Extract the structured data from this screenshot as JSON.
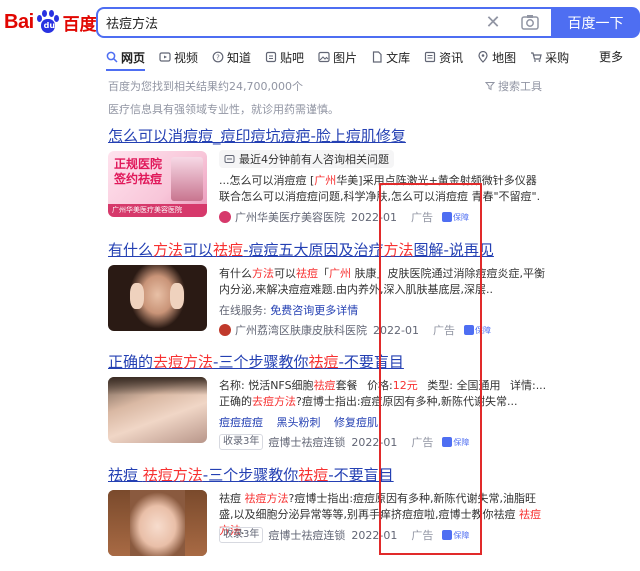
{
  "logo": {
    "bai": "Bai",
    "du": "百度"
  },
  "search": {
    "query": "祛痘方法",
    "button": "百度一下"
  },
  "tabs": [
    {
      "label": "网页",
      "icon": "search-icon"
    },
    {
      "label": "视频",
      "icon": "video-icon"
    },
    {
      "label": "知道",
      "icon": "question-icon"
    },
    {
      "label": "贴吧",
      "icon": "forum-icon"
    },
    {
      "label": "图片",
      "icon": "image-icon"
    },
    {
      "label": "文库",
      "icon": "document-icon"
    },
    {
      "label": "资讯",
      "icon": "news-icon"
    },
    {
      "label": "地图",
      "icon": "map-icon"
    },
    {
      "label": "采购",
      "icon": "cart-icon"
    }
  ],
  "more": "更多",
  "stats": "百度为您找到相关结果约24,700,000个",
  "tools": "搜索工具",
  "notice": "医疗信息具有强领域专业性，就诊用药需谨慎。",
  "results": [
    {
      "title": "怎么可以消痘痘_痘印痘坑痘疤-脸上痘肌修复",
      "sub": "最近4分钟前有人咨询相关问题",
      "thumb_text": "正规医院 签约祛痘",
      "thumb_caption": "广州华美医疗美容医院",
      "desc_a": "...怎么可以消痘痘 [",
      "desc_hl": "广州",
      "desc_b": "华美]采用点阵激光+黄金射频微针多仪器联合怎么可以消痘痘问题,科学净肤,怎么可以消痘痘 青春\"不留痘\".",
      "source": "广州华美医疗美容医院",
      "date": "2022-01",
      "ad": "广告",
      "guarantee": "保障"
    },
    {
      "title_a": "有什么",
      "title_hl1": "方法",
      "title_b": "可以",
      "title_hl2": "祛痘",
      "title_c": "-痘痘五大原因及治疗",
      "title_hl3": "方法",
      "title_d": "图解-说再见",
      "desc_a": "有什么",
      "desc_hl1": "方法",
      "desc_b": "可以",
      "desc_hl2": "祛痘",
      "desc_c": "「",
      "desc_hl3": "广州",
      "desc_d": " 肤康」皮肤医院通过消除痘痘炎症,平衡内分泌,来解决痘痘难题.由内养外,深入肌肤基底层,深层..",
      "online_label": "在线服务:",
      "online_link": "免费咨询更多详情",
      "source": "广州荔湾区肤康皮肤科医院",
      "date": "2022-01",
      "ad": "广告",
      "guarantee": "保障"
    },
    {
      "title_a": "正确的",
      "title_hl1": "去痘方法",
      "title_b": "-三个步骤教你",
      "title_hl2": "祛痘",
      "title_c": "-不要盲目",
      "line1_a": "名称: 悦活NFS细胞",
      "line1_hl": "祛痘",
      "line1_b": "套餐",
      "price_label": "价格:",
      "price": "12元",
      "type_label": "类型: 全国通用",
      "detail": "详情:...",
      "desc_a": "正确的",
      "desc_hl": "去痘方法",
      "desc_b": "?痘博士指出:痘痘原因有多种,新陈代谢失常...",
      "links": [
        "痘痘痘痘",
        "黑头粉刺",
        "修复痘肌"
      ],
      "tag": "收录3年",
      "source": "痘博士祛痘连锁",
      "date": "2022-01",
      "ad": "广告",
      "guarantee": "保障"
    },
    {
      "title_a": "祛痘 ",
      "title_hl1": "祛痘方法",
      "title_b": "-三个步骤教你",
      "title_hl2": "祛痘",
      "title_c": "-不要盲目",
      "desc_a": "祛痘 ",
      "desc_hl1": "祛痘方法",
      "desc_b": "?痘博士指出:痘痘原因有多种,新陈代谢失常,油脂旺盛,以及细胞分泌异常等等,别再手痒挤痘痘啦,痘博士教你祛痘 ",
      "desc_hl2": "祛痘方法",
      "desc_c": ".",
      "tag": "收录3年",
      "source": "痘博士祛痘连锁",
      "date": "2022-01",
      "ad": "广告",
      "guarantee": "保障"
    }
  ],
  "colors": {
    "brand_blue": "#4e6ef2",
    "link": "#2440b3",
    "highlight": "#f73131",
    "frame": "#e12a2a"
  }
}
